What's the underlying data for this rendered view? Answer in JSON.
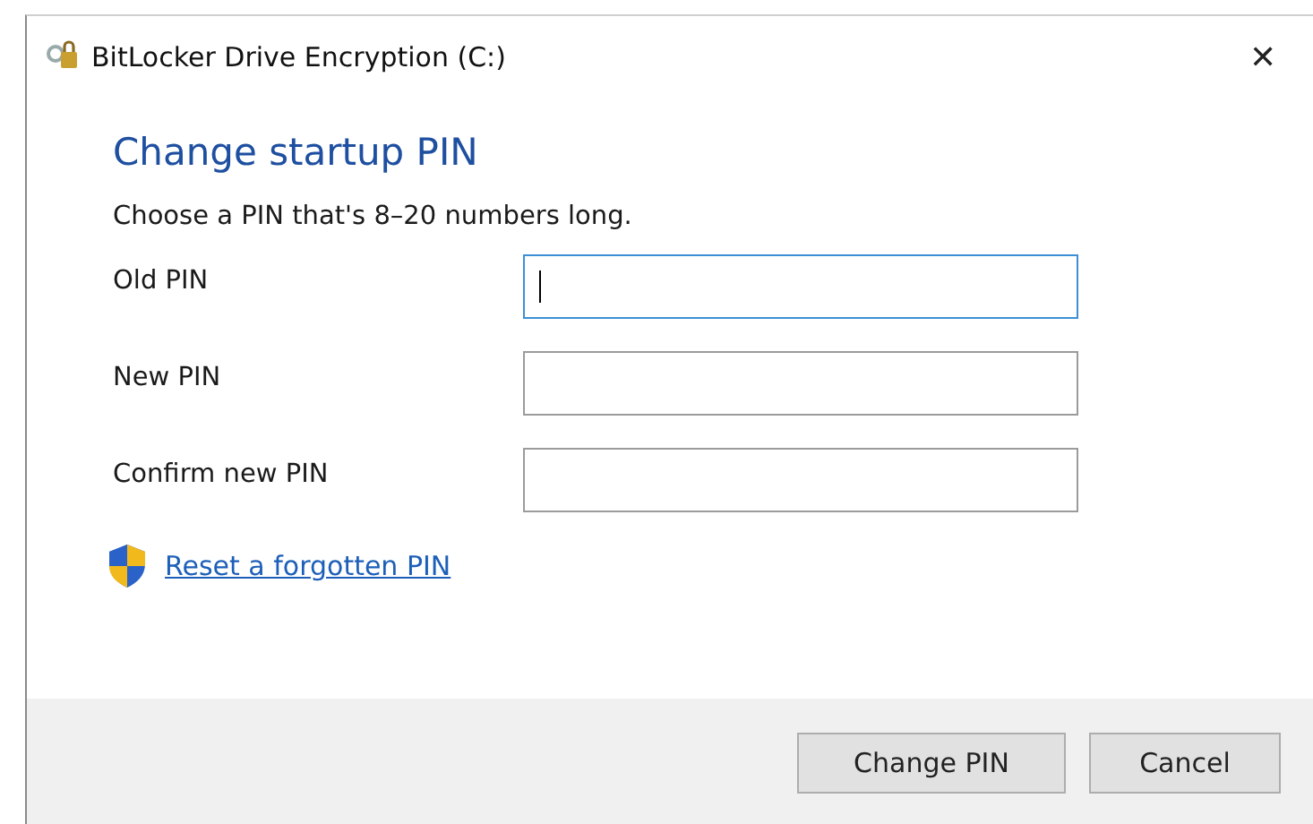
{
  "window": {
    "title": "BitLocker Drive Encryption (C:)",
    "close": "✕"
  },
  "heading": "Change startup PIN",
  "instruction": "Choose a PIN that's 8–20 numbers long.",
  "fields": [
    {
      "label": "Old PIN",
      "focused": true
    },
    {
      "label": "New PIN",
      "focused": false
    },
    {
      "label": "Confirm new PIN",
      "focused": false
    }
  ],
  "link": "Reset a forgotten PIN",
  "buttons": [
    "Change PIN",
    "Cancel"
  ]
}
